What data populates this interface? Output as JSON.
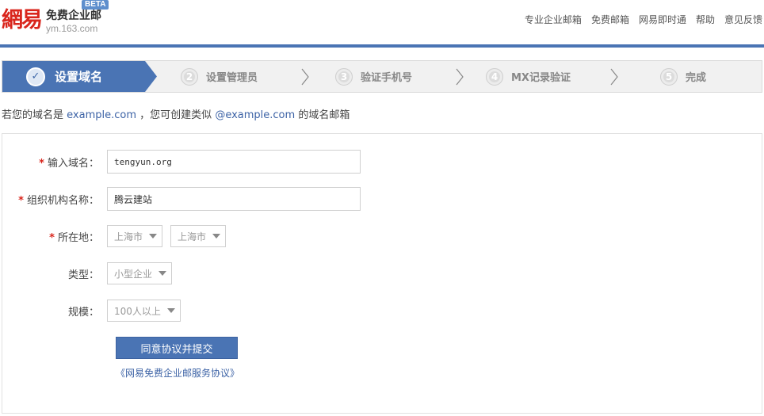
{
  "header": {
    "logo_mark": "網易",
    "logo_title": "免费企业邮",
    "logo_domain": "ym.163.com",
    "beta": "BETA",
    "nav": [
      "专业企业邮箱",
      "免费邮箱",
      "网易即时通",
      "帮助",
      "意见反馈"
    ]
  },
  "steps": {
    "active_label": "设置域名",
    "items": [
      {
        "num": "2",
        "label": "设置管理员"
      },
      {
        "num": "3",
        "label": "验证手机号"
      },
      {
        "num": "4",
        "label": "MX记录验证"
      },
      {
        "num": "5",
        "label": "完成"
      }
    ]
  },
  "hint": {
    "prefix": "若您的域名是",
    "example_domain": "example.com",
    "middle": "，您可创建类似",
    "example_mail": "@example.com",
    "suffix": "的域名邮箱"
  },
  "form": {
    "required_mark": "*",
    "domain_label": "输入域名：",
    "domain_value": "tengyun.org",
    "org_label": "组织机构名称：",
    "org_value": "腾云建站",
    "location_label": "所在地：",
    "province": "上海市",
    "city": "上海市",
    "type_label": "类型：",
    "type_value": "小型企业",
    "scale_label": "规模：",
    "scale_value": "100人以上",
    "submit_label": "同意协议并提交",
    "agreement_link": "《网易免费企业邮服务协议》"
  },
  "colors": {
    "brand_blue": "#4a74b4",
    "logo_red": "#d9251c",
    "link_blue": "#3d63a6"
  }
}
